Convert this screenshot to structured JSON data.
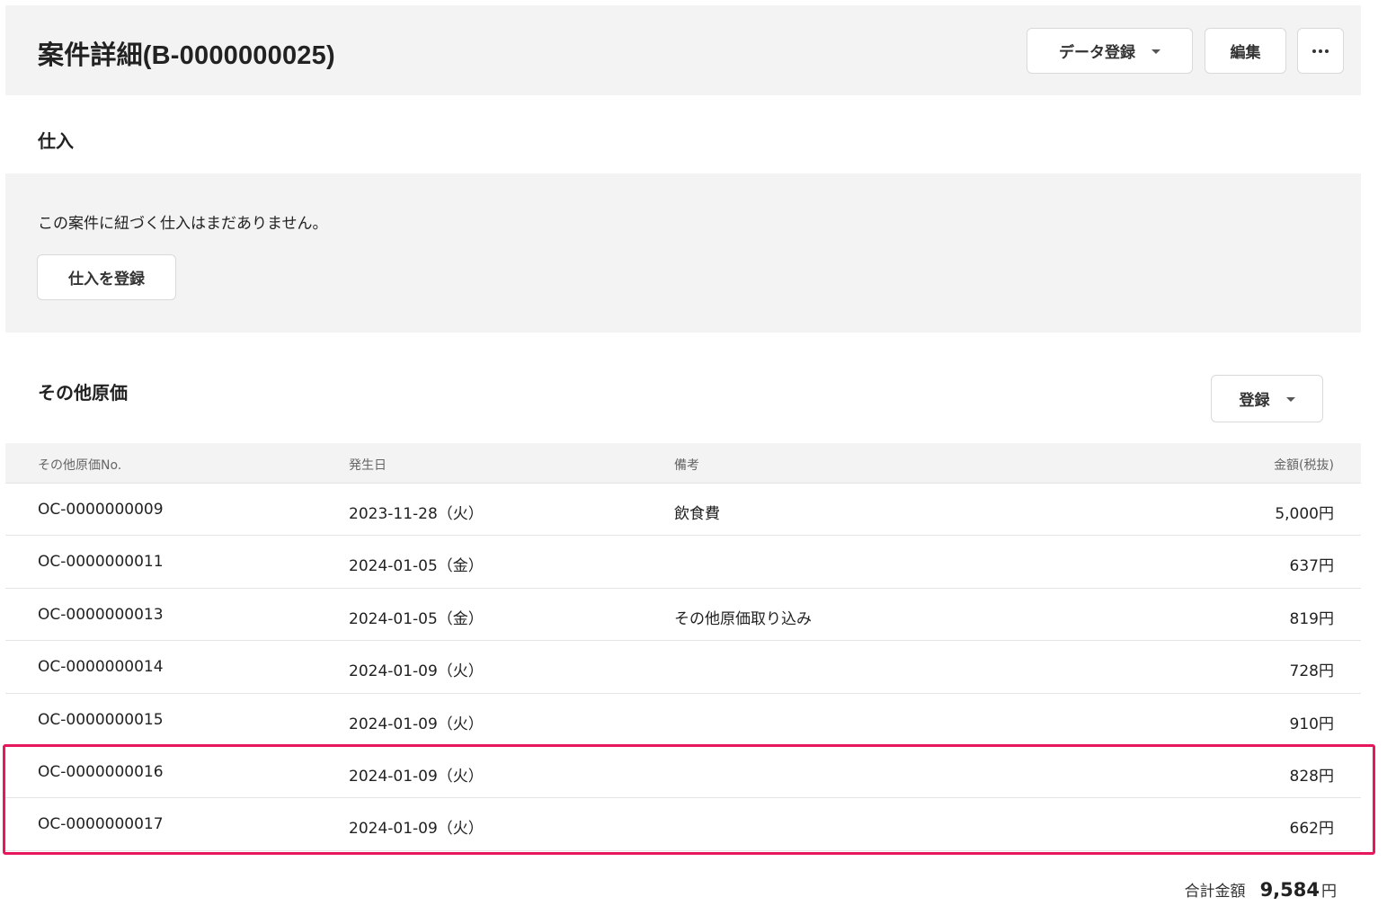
{
  "header": {
    "title": "案件詳細(B-0000000025)",
    "data_register_label": "データ登録",
    "edit_label": "編集",
    "more_icon": "more-horizontal-icon"
  },
  "purchase": {
    "title": "仕入",
    "empty_message": "この案件に紐づく仕入はまだありません。",
    "register_button": "仕入を登録"
  },
  "other_costs": {
    "title": "その他原価",
    "register_button": "登録",
    "columns": {
      "no": "その他原価No.",
      "date": "発生日",
      "note": "備考",
      "amount": "金額(税抜)"
    },
    "rows": [
      {
        "no": "OC-0000000009",
        "date": "2023-11-28（火）",
        "note": "飲食費",
        "amount": "5,000円"
      },
      {
        "no": "OC-0000000011",
        "date": "2024-01-05（金）",
        "note": "",
        "amount": "637円"
      },
      {
        "no": "OC-0000000013",
        "date": "2024-01-05（金）",
        "note": "その他原価取り込み",
        "amount": "819円"
      },
      {
        "no": "OC-0000000014",
        "date": "2024-01-09（火）",
        "note": "",
        "amount": "728円"
      },
      {
        "no": "OC-0000000015",
        "date": "2024-01-09（火）",
        "note": "",
        "amount": "910円"
      },
      {
        "no": "OC-0000000016",
        "date": "2024-01-09（火）",
        "note": "",
        "amount": "828円"
      },
      {
        "no": "OC-0000000017",
        "date": "2024-01-09（火）",
        "note": "",
        "amount": "662円"
      }
    ],
    "total_label": "合計金額",
    "total_value": "9,584",
    "total_unit": "円"
  },
  "colors": {
    "highlight": "#e6175c",
    "panel_bg": "#f4f3f4"
  }
}
